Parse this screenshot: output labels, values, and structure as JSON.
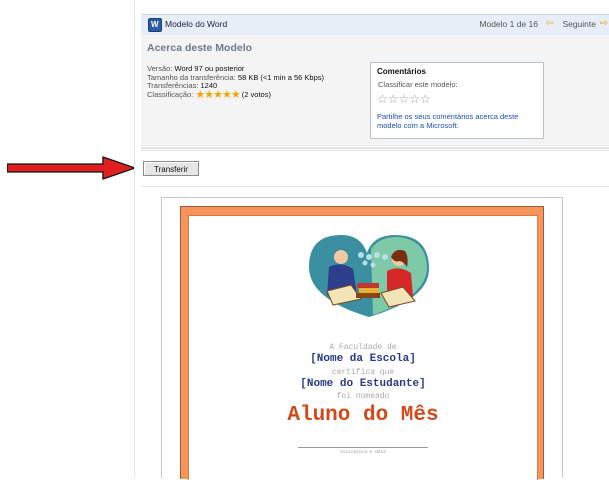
{
  "header": {
    "title": "Modelo do Word",
    "counter": "Modelo 1 de 16",
    "next_label": "Seguinte",
    "word_icon_letter": "W"
  },
  "info": {
    "title": "Acerca deste Modelo",
    "version_label": "Versão:",
    "version_value": "Word 97 ou posterior",
    "size_label": "Tamanho da transferência:",
    "size_value": "58 KB (<1 min a 56 Kbps)",
    "downloads_label": "Transferências:",
    "downloads_value": "1240",
    "rating_label": "Classificação:",
    "rating_stars": "★★★★★",
    "rating_votes": "(2 votos)",
    "rating_value": 5
  },
  "comments": {
    "title": "Comentários",
    "rate_prompt": "Classificar este modelo:",
    "empty_stars": "☆☆☆☆☆",
    "feedback_link": "Partilhe os seus comentários acerca deste modelo com a Microsoft:"
  },
  "download_button": "Transferir",
  "certificate": {
    "line1": "A Faculdade de",
    "line2": "[Nome da Escola]",
    "line3": "certifica que",
    "line4": "[Nome do Estudante]",
    "line5": "foi nomeado",
    "line6": "Aluno do Mês",
    "signature": "Assinatura e data"
  },
  "colors": {
    "header_bg": "#e7eef8",
    "cert_border": "#f7945a",
    "cert_title": "#d24a1a",
    "cert_names": "#2b3a8a",
    "arrow": "#e02020",
    "link": "#1a4fb8",
    "star": "#f0a800"
  },
  "icons": {
    "prev": "prev-arrow-icon",
    "next": "next-arrow-icon",
    "word": "word-document-icon"
  }
}
